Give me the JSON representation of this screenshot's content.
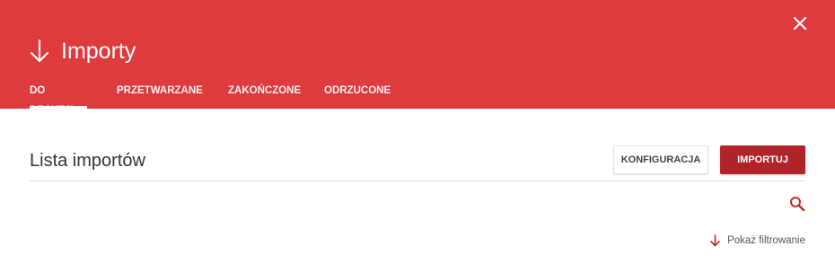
{
  "header": {
    "title": "Importy",
    "title_icon": "arrow-down-icon",
    "close_icon": "close-icon",
    "background_color": "#dd3b3e",
    "tabs": [
      {
        "label": "DO DECYZJI",
        "active": true
      },
      {
        "label": "PRZETWARZANE",
        "active": false
      },
      {
        "label": "ZAKOŃCZONE",
        "active": false
      },
      {
        "label": "ODRZUCONE",
        "active": false
      }
    ]
  },
  "main": {
    "section_title": "Lista importów",
    "config_button_label": "KONFIGURACJA",
    "import_button_label": "IMPORTUJ",
    "import_button_color": "#b02429",
    "search_icon": "search-icon",
    "filter_toggle_label": "Pokaż filtrowanie",
    "filter_toggle_icon": "arrow-down-icon"
  }
}
